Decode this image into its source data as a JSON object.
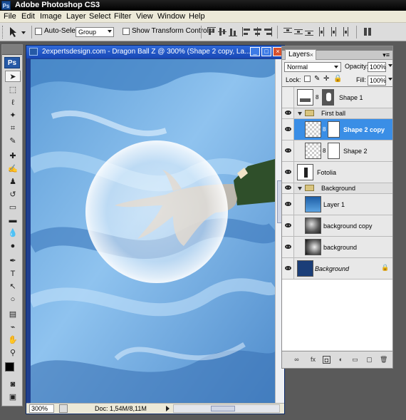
{
  "app": {
    "title": "Adobe Photoshop CS3",
    "icon_text": "Ps"
  },
  "menu": [
    "File",
    "Edit",
    "Image",
    "Layer",
    "Select",
    "Filter",
    "View",
    "Window",
    "Help"
  ],
  "options": {
    "auto_select_label": "Auto-Select:",
    "auto_select_value": "Group",
    "show_transform_label": "Show Transform Controls"
  },
  "tools": {
    "ps_logo": "Ps",
    "items": [
      "move-tool",
      "marquee-tool",
      "lasso-tool",
      "magic-wand-tool",
      "crop-tool",
      "slice-tool",
      "healing-tool",
      "brush-tool",
      "clone-stamp-tool",
      "history-brush-tool",
      "eraser-tool",
      "gradient-tool",
      "blur-tool",
      "dodge-tool",
      "pen-tool",
      "type-tool",
      "path-select-tool",
      "shape-tool",
      "notes-tool",
      "eyedropper-tool",
      "hand-tool",
      "zoom-tool"
    ]
  },
  "document": {
    "title": "2expertsdesign.com - Dragon Ball Z @ 300% (Shape 2 copy, La...",
    "zoom": "300%",
    "doc_info": "Doc: 1,54M/8,11M"
  },
  "layers_panel": {
    "tab_label": "Layers",
    "blend_mode": "Normal",
    "opacity_label": "Opacity:",
    "opacity_value": "100%",
    "lock_label": "Lock:",
    "fill_label": "Fill:",
    "fill_value": "100%",
    "layers": [
      {
        "name": "Shape 1",
        "visible": false
      },
      {
        "name": "First ball",
        "visible": true,
        "group": true
      },
      {
        "name": "Shape 2 copy",
        "visible": true,
        "selected": true
      },
      {
        "name": "Shape 2",
        "visible": true
      },
      {
        "name": "Fotolia",
        "visible": true
      },
      {
        "name": "Background",
        "visible": true,
        "group": true
      },
      {
        "name": "Layer 1",
        "visible": true
      },
      {
        "name": "background copy",
        "visible": true
      },
      {
        "name": "background",
        "visible": true
      },
      {
        "name": "Background",
        "visible": true,
        "locked": true
      }
    ]
  },
  "colors": {
    "selection": "#3a8ee6",
    "doc_title": "#1847b5",
    "canvas_sky": "#6aa8de"
  }
}
